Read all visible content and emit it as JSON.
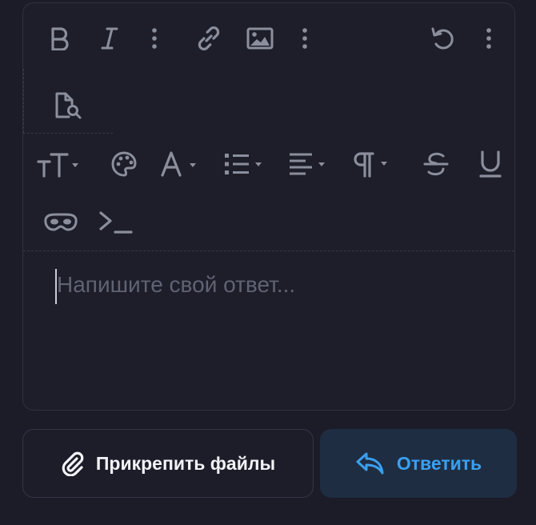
{
  "editor": {
    "placeholder": "Напишите свой ответ...",
    "toolbar_row1": [
      "bold-icon",
      "italic-icon",
      "more-vertical-icon",
      "link-icon",
      "image-icon",
      "more-vertical-icon",
      "undo-icon",
      "more-vertical-icon"
    ],
    "toolbar_row2": [
      "preview-document-icon"
    ],
    "toolbar_row3": [
      "font-size-icon",
      "palette-icon",
      "text-color-icon",
      "list-icon",
      "align-icon",
      "paragraph-icon",
      "strikethrough-icon",
      "underline-icon"
    ],
    "toolbar_row4": [
      "spoiler-mask-icon",
      "code-terminal-icon"
    ]
  },
  "actions": {
    "attach_label": "Прикрепить файлы",
    "reply_label": "Ответить"
  },
  "colors": {
    "background": "#1b1c28",
    "icon": "#8b8e9c",
    "accent": "#3aa0f0",
    "reply_bg": "#1f2d42"
  }
}
